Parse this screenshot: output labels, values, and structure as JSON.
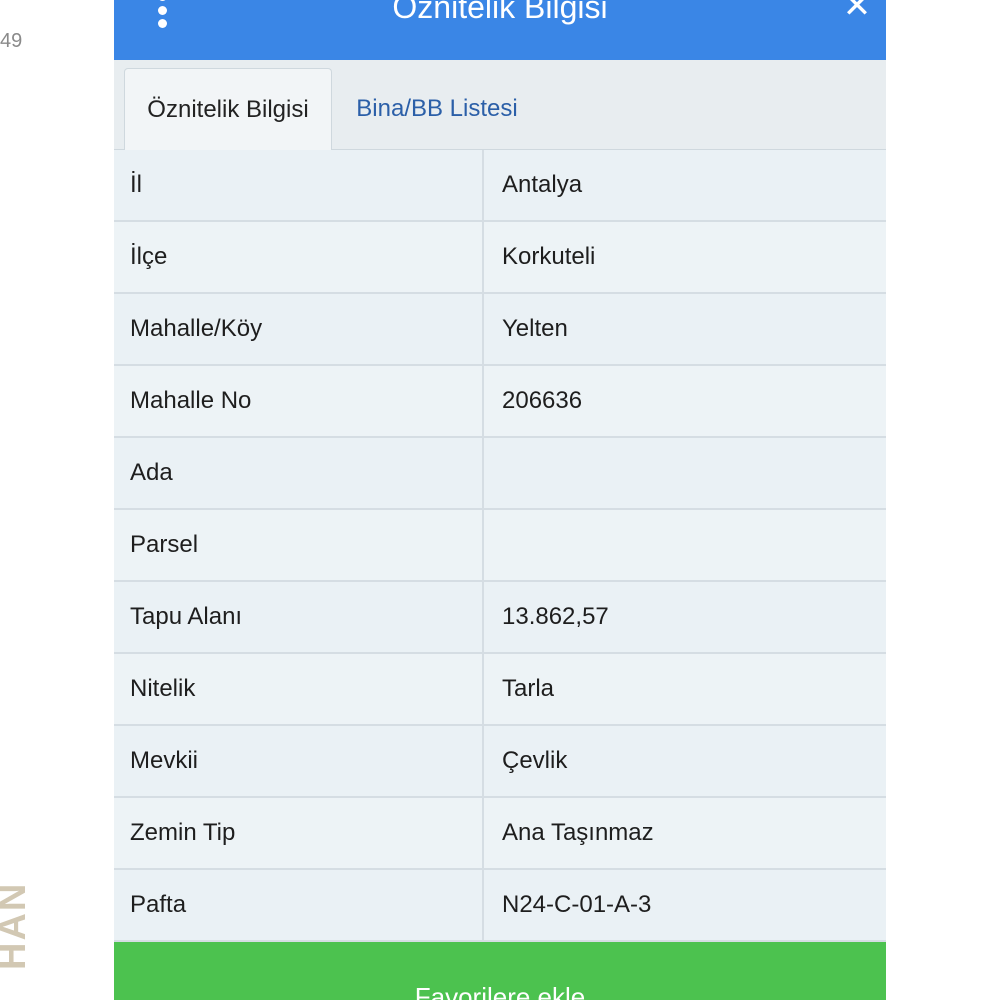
{
  "page": {
    "side_text": "49",
    "side_vertical_text": "HAN"
  },
  "header": {
    "title": "Öznitelik Bilgisi",
    "menu_icon": "kebab-menu-icon",
    "close_icon": "close-icon",
    "close_symbol": "✕",
    "color": "#3a86e6"
  },
  "tabs": [
    {
      "label": "Öznitelik Bilgisi",
      "active": true
    },
    {
      "label": "Bina/BB Listesi",
      "active": false
    }
  ],
  "attributes": [
    {
      "label": "İl",
      "value": "Antalya"
    },
    {
      "label": "İlçe",
      "value": "Korkuteli"
    },
    {
      "label": "Mahalle/Köy",
      "value": "Yelten"
    },
    {
      "label": "Mahalle No",
      "value": "206636"
    },
    {
      "label": "Ada",
      "value": ""
    },
    {
      "label": "Parsel",
      "value": ""
    },
    {
      "label": "Tapu Alanı",
      "value": "13.862,57"
    },
    {
      "label": "Nitelik",
      "value": "Tarla"
    },
    {
      "label": "Mevkii",
      "value": "Çevlik"
    },
    {
      "label": "Zemin Tip",
      "value": "Ana Taşınmaz"
    },
    {
      "label": "Pafta",
      "value": "N24-C-01-A-3"
    }
  ],
  "footer": {
    "favorite_label": "Favorilere ekle",
    "color": "#4cc24f"
  }
}
